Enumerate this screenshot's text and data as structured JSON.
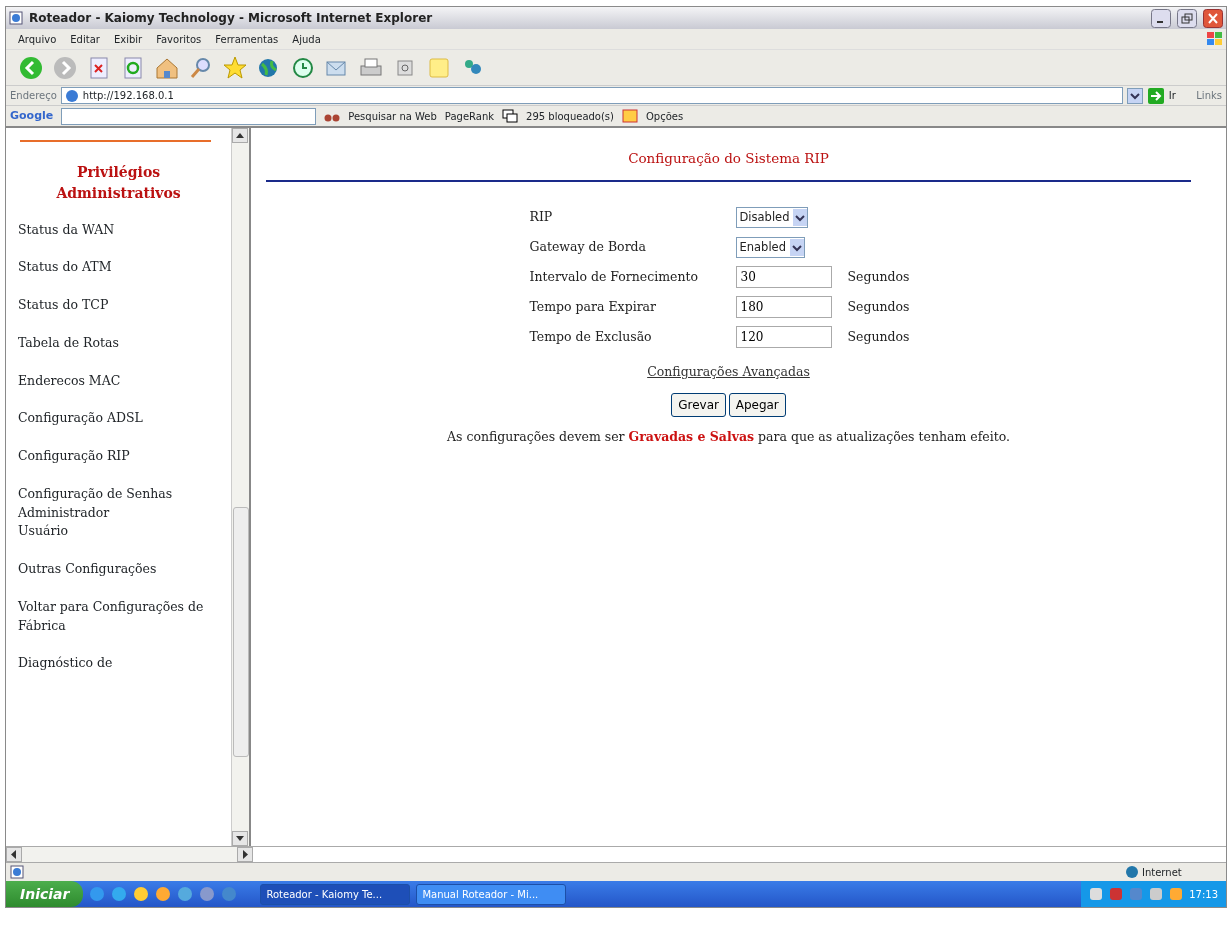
{
  "window": {
    "title": "Roteador - Kaiomy Technology - Microsoft Internet Explorer"
  },
  "menu": [
    "Arquivo",
    "Editar",
    "Exibir",
    "Favoritos",
    "Ferramentas",
    "Ajuda"
  ],
  "address": {
    "label": "Endereço",
    "url": "http://192.168.0.1",
    "go": "Ir",
    "links": "Links"
  },
  "google_bar": {
    "logo": "Google",
    "search_web": "Pesquisar na Web",
    "pagerank": "PageRank",
    "blocked": "295 bloqueado(s)",
    "options": "Opções"
  },
  "sidebar": {
    "heading": "Privilégios Administrativos",
    "items": [
      {
        "label": "Status da WAN"
      },
      {
        "label": "Status do ATM"
      },
      {
        "label": "Status do TCP"
      },
      {
        "label": "Tabela de Rotas"
      },
      {
        "label": "Enderecos MAC"
      },
      {
        "label": "Configuração ADSL"
      },
      {
        "label": "Configuração RIP"
      },
      {
        "label": "Configuração de Senhas",
        "children": [
          {
            "label": "Administrador"
          },
          {
            "label": "Usuário"
          }
        ]
      },
      {
        "label": "Outras Configurações"
      },
      {
        "label": "Voltar para Configurações de Fábrica"
      },
      {
        "label": "Diagnóstico de"
      }
    ]
  },
  "main": {
    "title": "Configuração do Sistema RIP",
    "fields": [
      {
        "kind": "select",
        "label": "RIP",
        "value": "Disabled"
      },
      {
        "kind": "select",
        "label": "Gateway de Borda",
        "value": "Enabled"
      },
      {
        "kind": "input",
        "label": "Intervalo de Fornecimento",
        "value": "30",
        "unit": "Segundos"
      },
      {
        "kind": "input",
        "label": "Tempo para Expirar",
        "value": "180",
        "unit": "Segundos"
      },
      {
        "kind": "input",
        "label": "Tempo de Exclusão",
        "value": "120",
        "unit": "Segundos"
      }
    ],
    "link": "Configurações Avançadas",
    "buttons": [
      "Grevar",
      "Apegar"
    ],
    "note": "As configurações devem ser **Gravadas e Salvas** para que as atualizações tenham efeito."
  },
  "status_bar": {
    "zone": "Internet"
  },
  "taskbar": {
    "start": "Iniciar",
    "windows": [
      {
        "label": "Roteador - Kaiomy Te...",
        "selected": true
      },
      {
        "label": "Manual Roteador - Mi...",
        "selected": false
      }
    ],
    "clock": "17:13"
  }
}
